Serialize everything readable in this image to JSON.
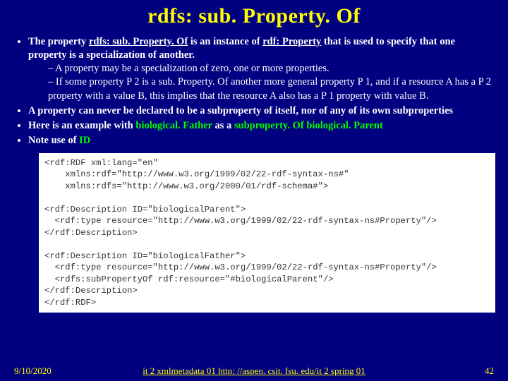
{
  "title": "rdfs: sub. Property. Of",
  "bullets": {
    "b1_pre": "The property ",
    "b1_u1": "rdfs: sub. Property. Of",
    "b1_mid": " is an instance of ",
    "b1_u2": "rdf: Property",
    "b1_post": " that is used to specify that one property is a specialization of another.",
    "b1_sub1": "A property may be a specialization of zero, one or more properties.",
    "b1_sub2": "If some property P 2 is a sub. Property. Of another more general property P 1, and if a resource A has a P 2 property with a value B, this implies that the resource A also has a P 1 property with value B.",
    "b2": "A property can never be declared to be a subproperty of itself, nor of any of its own subproperties",
    "b3_pre": "Here is an example with ",
    "b3_g1": "biological. Father",
    "b3_mid": " as a ",
    "b3_g2": "subproperty. Of biological. Parent",
    "b4_pre": "Note use of ",
    "b4_g": "ID"
  },
  "code": "<rdf:RDF xml:lang=\"en\"\n    xmlns:rdf=\"http://www.w3.org/1999/02/22-rdf-syntax-ns#\"\n    xmlns:rdfs=\"http://www.w3.org/2000/01/rdf-schema#\">\n\n<rdf:Description ID=\"biologicalParent\">\n  <rdf:type resource=\"http://www.w3.org/1999/02/22-rdf-syntax-ns#Property\"/>\n</rdf:Description>\n\n<rdf:Description ID=\"biologicalFather\">\n  <rdf:type resource=\"http://www.w3.org/1999/02/22-rdf-syntax-ns#Property\"/>\n  <rdfs:subPropertyOf rdf:resource=\"#biologicalParent\"/>\n</rdf:Description>\n</rdf:RDF>",
  "footer": {
    "date": "9/10/2020",
    "center": "it 2 xmlmetadata 01  http: //aspen. csit. fsu. edu/it 2 spring 01",
    "page": "42"
  }
}
